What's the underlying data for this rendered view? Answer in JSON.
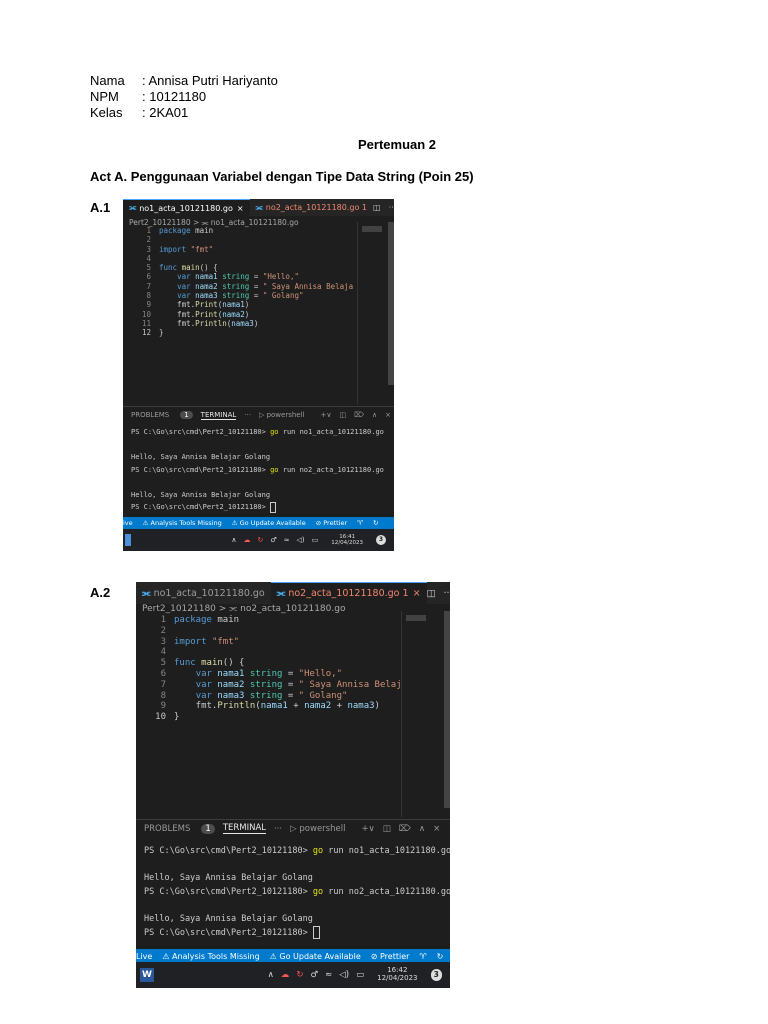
{
  "header": {
    "nama_label": "Nama",
    "nama_value": ": Annisa Putri Hariyanto",
    "npm_label": "NPM",
    "npm_value": ": 10121180",
    "kelas_label": "Kelas",
    "kelas_value": ": 2KA01"
  },
  "meeting_title": "Pertemuan 2",
  "section_title": "Act A. Penggunaan Variabel dengan Tipe Data String (Poin 25)",
  "screens": [
    {
      "label": "A.1",
      "tabs": [
        {
          "icon": "go-file-icon",
          "label": "no1_acta_10121180.go",
          "close": "×"
        },
        {
          "icon": "go-file-icon",
          "label": "no2_acta_10121180.go 1"
        }
      ],
      "breadcrumb": "Pert2_10121180 > ⫘ no1_acta_10121180.go",
      "code": [
        {
          "n": "1",
          "t": "package main"
        },
        {
          "n": "2",
          "t": ""
        },
        {
          "n": "3",
          "t": "import \"fmt\""
        },
        {
          "n": "4",
          "t": ""
        },
        {
          "n": "5",
          "t": "func main() {"
        },
        {
          "n": "6",
          "t": "    var nama1 string = \"Hello,\""
        },
        {
          "n": "7",
          "t": "    var nama2 string = \" Saya Annisa Belaja"
        },
        {
          "n": "8",
          "t": "    var nama3 string = \" Golang\""
        },
        {
          "n": "9",
          "t": "    fmt.Print(nama1)"
        },
        {
          "n": "10",
          "t": "    fmt.Print(nama2)"
        },
        {
          "n": "11",
          "t": "    fmt.Println(nama3)"
        },
        {
          "n": "12",
          "t": "}"
        }
      ],
      "panel": {
        "problems": "PROBLEMS",
        "problems_count": "1",
        "terminal": "TERMINAL",
        "more": "···",
        "shell": "powershell"
      },
      "terminal": [
        "PS C:\\Go\\src\\cmd\\Pert2_10121180> go run no1_acta_10121180.go",
        "",
        "Hello, Saya Annisa Belajar Golang",
        "PS C:\\Go\\src\\cmd\\Pert2_10121180> go run no2_acta_10121180.go",
        "",
        "Hello, Saya Annisa Belajar Golang",
        "PS C:\\Go\\src\\cmd\\Pert2_10121180> "
      ],
      "status": [
        "ive",
        "⚠ Analysis Tools Missing",
        "⚠ Go Update Available",
        "⊘ Prettier"
      ],
      "clock_time": "16:41",
      "clock_date": "12/04/2023",
      "notif_count": "3"
    },
    {
      "label": "A.2",
      "tabs": [
        {
          "icon": "go-file-icon",
          "label": "no1_acta_10121180.go"
        },
        {
          "icon": "go-file-icon",
          "label": "no2_acta_10121180.go 1",
          "close": "×"
        }
      ],
      "breadcrumb": "Pert2_10121180 > ⫘ no2_acta_10121180.go",
      "code": [
        {
          "n": "1",
          "t": "package main"
        },
        {
          "n": "2",
          "t": ""
        },
        {
          "n": "3",
          "t": "import \"fmt\""
        },
        {
          "n": "4",
          "t": ""
        },
        {
          "n": "5",
          "t": "func main() {"
        },
        {
          "n": "6",
          "t": "    var nama1 string = \"Hello,\""
        },
        {
          "n": "7",
          "t": "    var nama2 string = \" Saya Annisa Belaja"
        },
        {
          "n": "8",
          "t": "    var nama3 string = \" Golang\""
        },
        {
          "n": "9",
          "t": "    fmt.Println(nama1 + nama2 + nama3)"
        },
        {
          "n": "10",
          "t": "}"
        }
      ],
      "panel": {
        "problems": "PROBLEMS",
        "problems_count": "1",
        "terminal": "TERMINAL",
        "more": "···",
        "shell": "powershell"
      },
      "terminal": [
        "PS C:\\Go\\src\\cmd\\Pert2_10121180> go run no1_acta_10121180.go",
        "",
        "Hello, Saya Annisa Belajar Golang",
        "PS C:\\Go\\src\\cmd\\Pert2_10121180> go run no2_acta_10121180.go",
        "",
        "Hello, Saya Annisa Belajar Golang",
        "PS C:\\Go\\src\\cmd\\Pert2_10121180> "
      ],
      "status": [
        "Live",
        "⚠ Analysis Tools Missing",
        "⚠ Go Update Available",
        "⊘ Prettier"
      ],
      "clock_time": "16:42",
      "clock_date": "12/04/2023",
      "notif_count": "3"
    }
  ]
}
